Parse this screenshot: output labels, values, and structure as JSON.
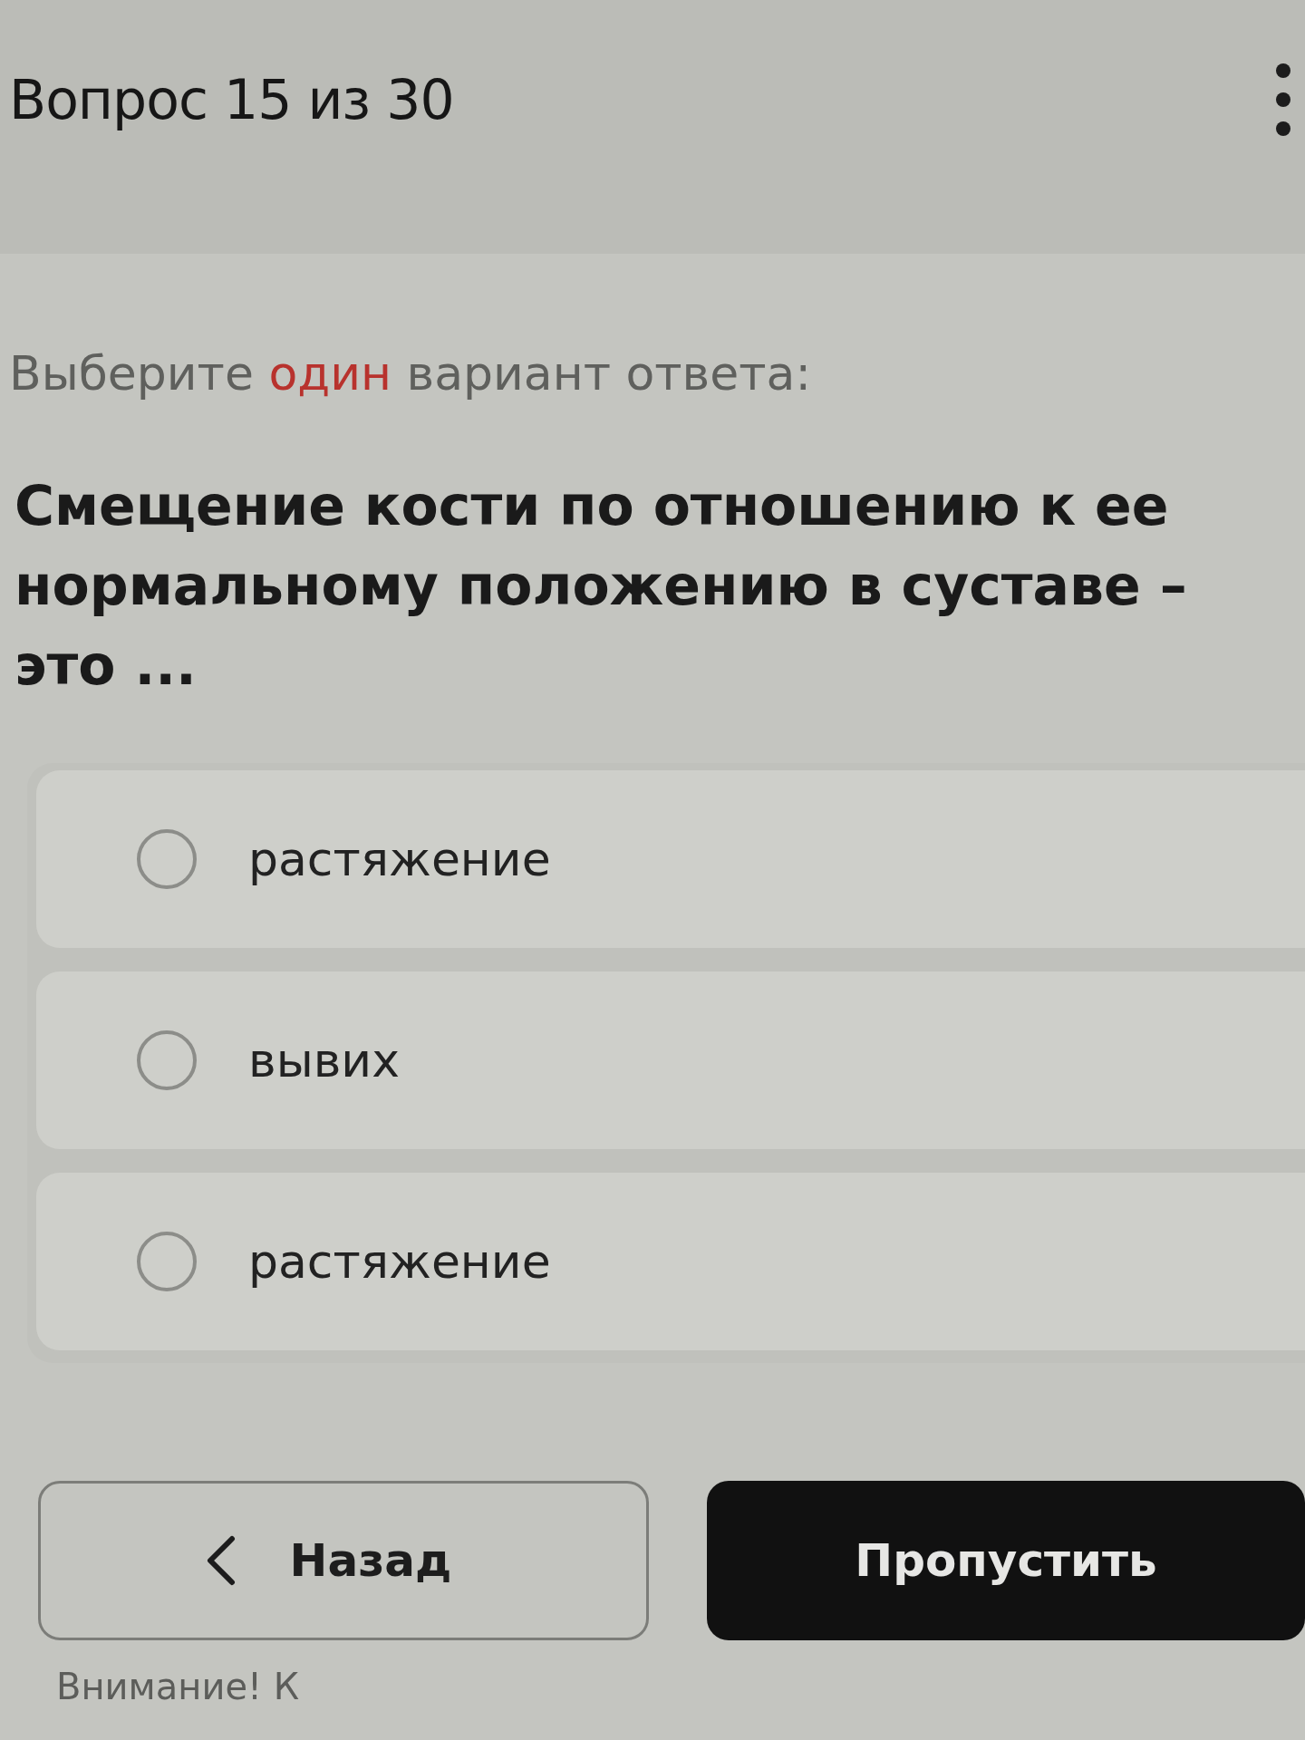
{
  "header": {
    "title": "Вопрос 15 из 30"
  },
  "instruction": {
    "text_before": "Выберите",
    "highlight": "один",
    "text_after": "вариант ответа:"
  },
  "question": {
    "text": "Смещение кости по отношению к ее нормальному положению в суставе – это ..."
  },
  "options": [
    {
      "label": "растяжение",
      "selected": false
    },
    {
      "label": "вывих",
      "selected": false
    },
    {
      "label": "растяжение",
      "selected": false
    }
  ],
  "buttons": [
    {
      "kind": "back",
      "label": "Назад"
    },
    {
      "kind": "skip",
      "label": "Пропустить"
    }
  ],
  "notice": {
    "text": "Внимание! К"
  }
}
